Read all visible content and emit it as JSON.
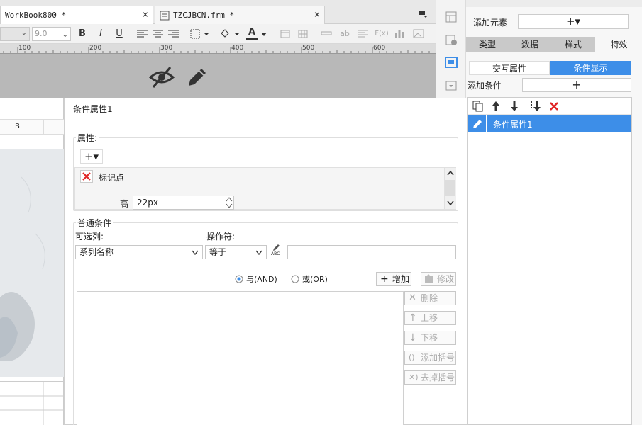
{
  "tabs": [
    {
      "title": "WorkBook800 *",
      "close": "×"
    },
    {
      "title": "TZCJBCN.frm *",
      "close": "×"
    }
  ],
  "toolbar": {
    "font_size": "9.0",
    "bold": "B",
    "italic": "I",
    "underline": "U",
    "font_color_glyph": "A",
    "wrap_glyph": "ab",
    "formula_glyph": "F(x)"
  },
  "ruler": [
    "100",
    "200",
    "300",
    "400",
    "500",
    "600"
  ],
  "sheet": {
    "column_b": "B"
  },
  "dialog": {
    "title": "条件属性1",
    "properties_label": "属性:",
    "add_glyph": "+▾",
    "marker_label": "标记点",
    "height_label": "高",
    "height_value": "22px",
    "normal_condition_label": "普通条件",
    "column_label": "可选列:",
    "operator_label": "操作符:",
    "column_value": "系列名称",
    "operator_value": "等于",
    "abc_glyph": "ABC",
    "and_label": "与(AND)",
    "or_label": "或(OR)",
    "add_button": "增加",
    "modify_button": "修改",
    "delete_button": "删除",
    "up_button": "上移",
    "down_button": "下移",
    "add_paren_button": "添加括号",
    "remove_paren_button": "去掉括号"
  },
  "panel": {
    "add_element_label": "添加元素",
    "add_element_glyph": "+▾",
    "tabs": [
      "类型",
      "数据",
      "样式",
      "特效"
    ],
    "subtabs": [
      "交互属性",
      "条件显示"
    ],
    "add_condition_label": "添加条件",
    "add_condition_glyph": "+",
    "list_item": "条件属性1"
  },
  "colors": {
    "accent": "#3d8ee8",
    "dark_tab": "#c9c9c9",
    "delete_red": "#e02424"
  }
}
